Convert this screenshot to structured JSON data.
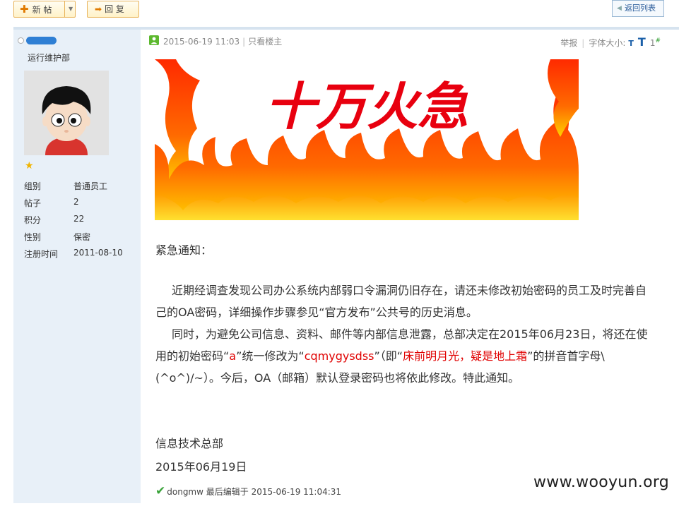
{
  "toolbar": {
    "new_post_label": "新 帖",
    "reply_label": "回 复",
    "back_to_list_label": "返回列表"
  },
  "author": {
    "department": "运行维护部",
    "stats": [
      {
        "label": "组别",
        "value": "普通员工"
      },
      {
        "label": "帖子",
        "value": "2"
      },
      {
        "label": "积分",
        "value": "22"
      },
      {
        "label": "性别",
        "value": "保密"
      },
      {
        "label": "注册时间",
        "value": "2011-08-10"
      }
    ]
  },
  "post": {
    "timestamp": "2015-06-19 11:03",
    "only_op_label": "只看楼主",
    "report_label": "举报",
    "font_size_label": "字体大小:",
    "font_small": "T",
    "font_large": "T",
    "floor_number": "1",
    "floor_mark": "#",
    "banner_text": "十万火急",
    "heading": "紧急通知：",
    "paragraph1": "近期经调查发现公司办公系统内部弱口令漏洞仍旧存在，请还未修改初始密码的员工及时完善自己的OA密码，详细操作步骤参见“官方发布”公共号的历史消息。",
    "p2_a": "同时，为避免公司信息、资料、邮件等内部信息泄露，总部决定在2015年06月23日，将还在使用的初始密码“",
    "p2_old_pwd": "a",
    "p2_b": "”统一修改为“",
    "p2_new_pwd": "cqmygysdss",
    "p2_c": "”（即“",
    "p2_poem": "床前明月光，疑是地上霜",
    "p2_d": "”的拼音首字母\\(^o^)/~）。今后，OA（邮箱）默认登录密码也将依此修改。特此通知。",
    "signature_org": "信息技术总部",
    "signature_date": "2015年06月19日",
    "edit_user": "dongmw",
    "edit_label": "最后编辑于",
    "edit_time": "2015-06-19 11:04:31"
  },
  "watermark": "www.wooyun.org",
  "colors": {
    "accent_red": "#e00000",
    "sidebar_bg": "#e8f0f8",
    "button_border": "#e8b35a"
  }
}
